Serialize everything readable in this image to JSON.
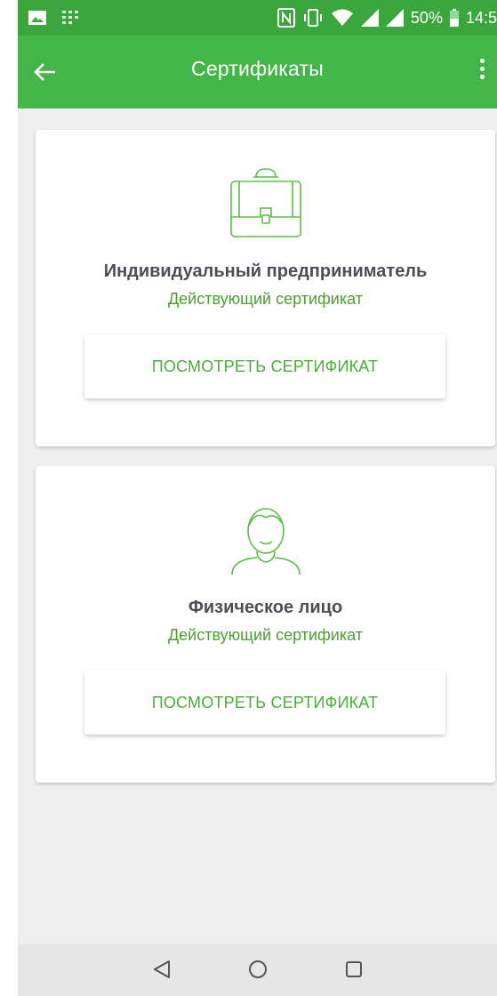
{
  "status_bar": {
    "battery_percent": "50%",
    "time": "14:5",
    "icons": [
      "gallery-icon",
      "grid-icon",
      "nfc-icon",
      "vibrate-icon",
      "wifi-icon",
      "signal-icon",
      "signal-icon",
      "battery-icon"
    ]
  },
  "app_bar": {
    "title": "Сертификаты",
    "back_icon": "arrow-left-icon",
    "menu_icon": "more-vert-icon"
  },
  "certificates": [
    {
      "icon": "briefcase-icon",
      "name": "Индивидуальный предприниматель",
      "status": "Действующий сертификат",
      "button_label": "ПОСМОТРЕТЬ СЕРТИФИКАТ"
    },
    {
      "icon": "person-icon",
      "name": "Физическое лицо",
      "status": "Действующий сертификат",
      "button_label": "ПОСМОТРЕТЬ СЕРТИФИКАТ"
    }
  ],
  "nav_bar": {
    "buttons": [
      "back-triangle-icon",
      "home-circle-icon",
      "recents-square-icon"
    ]
  },
  "colors": {
    "status_bar": "#3aa63d",
    "app_bar": "#44b649",
    "accent_green": "#48b036",
    "background": "#efefef"
  }
}
